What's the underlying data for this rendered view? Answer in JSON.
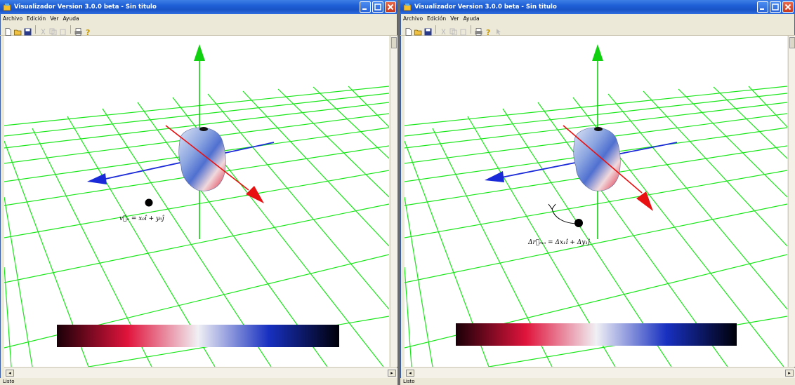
{
  "windows": [
    {
      "title": "Visualizador Version 3.0.0 beta - Sin titulo",
      "menu": [
        "Archivo",
        "Edición",
        "Ver",
        "Ayuda"
      ],
      "formula": "v⃗ₒ = x₀î + y₀ĵ",
      "status": "Listo"
    },
    {
      "title": "Visualizador Version 3.0.0 beta - Sin titulo",
      "menu": [
        "Archivo",
        "Edición",
        "Ver",
        "Ayuda"
      ],
      "formula": "Δr⃗ₘₒ = Δx₁î + Δy₁ĵ",
      "status": "Listo"
    }
  ],
  "colors": {
    "grid": "#19e619",
    "x_axis": "#e81010",
    "y_axis": "#10d010",
    "z_axis": "#1a2ad8",
    "colormap": [
      "#1a0008",
      "#e0143c",
      "#f0f0f4",
      "#1830c0",
      "#000008"
    ]
  }
}
